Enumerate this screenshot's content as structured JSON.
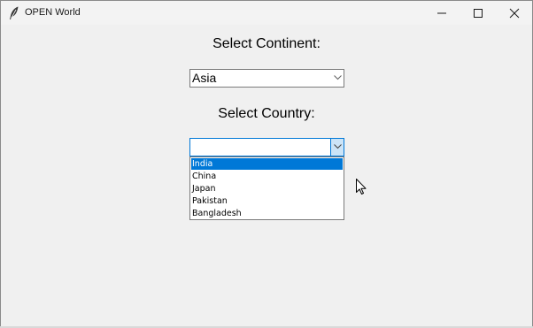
{
  "window": {
    "title": "OPEN World",
    "icon": "feather-icon"
  },
  "continent": {
    "label": "Select Continent:",
    "selected": "Asia"
  },
  "country": {
    "label": "Select Country:",
    "selected": "",
    "options": [
      "India",
      "China",
      "Japan",
      "Pakistan",
      "Bangladesh"
    ],
    "highlighted_option": "India"
  },
  "colors": {
    "accent": "#0078d7",
    "window_bg": "#f0f0f0"
  }
}
